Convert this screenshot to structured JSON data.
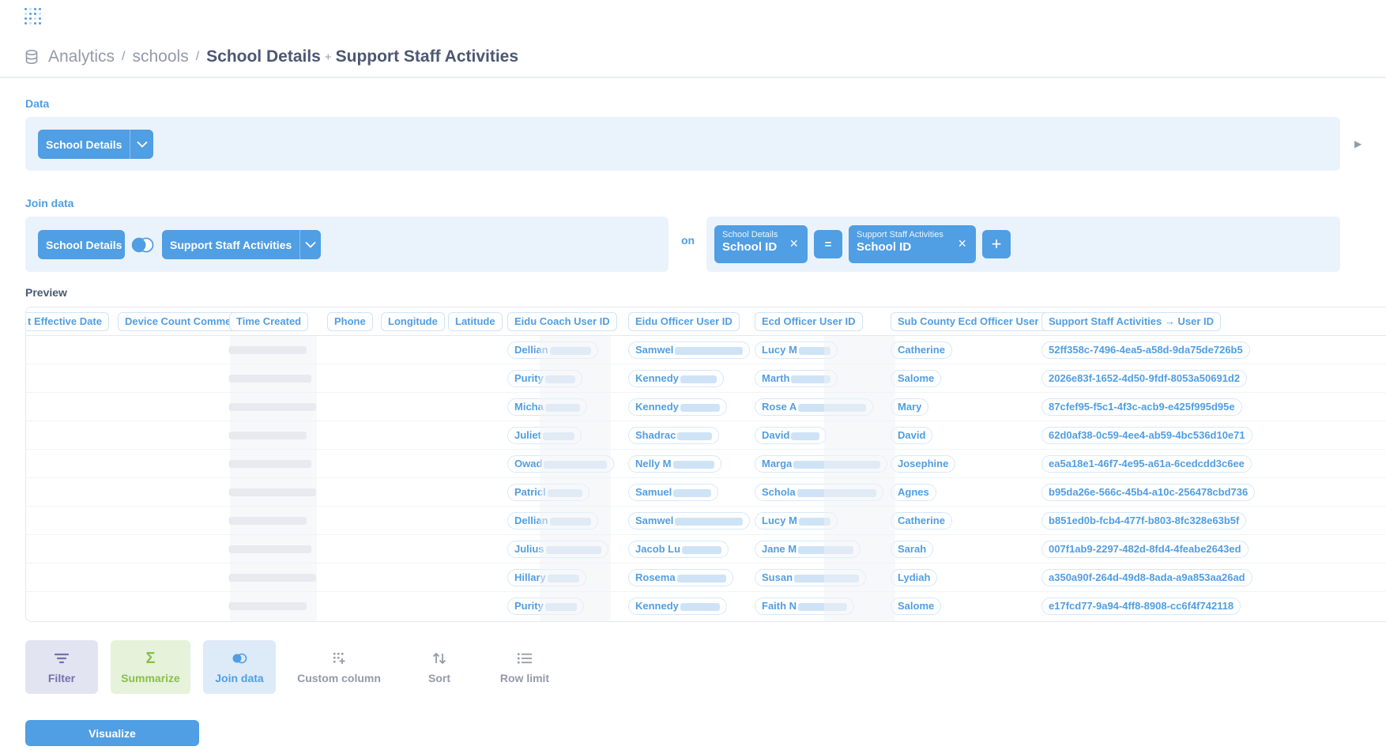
{
  "app": {
    "logo": "metabase-logo"
  },
  "breadcrumb": {
    "database": "Analytics",
    "schema": "schools",
    "table": "School Details",
    "plus": "+",
    "joined": "Support Staff Activities"
  },
  "data_section": {
    "label": "Data",
    "source": "School Details"
  },
  "join_section": {
    "label": "Join data",
    "left_table": "School Details",
    "right_table": "Support Staff Activities",
    "on_label": "on",
    "left_condition": {
      "table": "School Details",
      "column": "School ID"
    },
    "operator": "=",
    "right_condition": {
      "table": "Support Staff Activities",
      "column": "School ID"
    },
    "add_condition": "+"
  },
  "preview": {
    "label": "Preview",
    "columns": [
      "t Effective Date",
      "Device Count Comment",
      "Time Created",
      "Phone",
      "Longitude",
      "Latitude",
      "Eidu Coach User ID",
      "Eidu Officer User ID",
      "Ecd Officer User ID",
      "Sub County Ecd Officer User ID",
      "Support Staff Activities → User ID"
    ],
    "rows": [
      {
        "coach": "Dellian",
        "officer": "Samwel",
        "ecd": "Lucy M",
        "sub": "Catherine",
        "uid": "52ff358c-7496-4ea5-a58d-9da75de726b5"
      },
      {
        "coach": "Purity",
        "officer": "Kennedy",
        "ecd": "Marth",
        "sub": "Salome",
        "uid": "2026e83f-1652-4d50-9fdf-8053a50691d2"
      },
      {
        "coach": "Micha",
        "officer": "Kennedy",
        "ecd": "Rose A",
        "sub": "Mary",
        "uid": "87cfef95-f5c1-4f3c-acb9-e425f995d95e"
      },
      {
        "coach": "Juliet",
        "officer": "Shadrac",
        "ecd": "David",
        "sub": "David",
        "uid": "62d0af38-0c59-4ee4-ab59-4bc536d10e71"
      },
      {
        "coach": "Owad",
        "officer": "Nelly M",
        "ecd": "Marga",
        "sub": "Josephine",
        "uid": "ea5a18e1-46f7-4e95-a61a-6cedcdd3c6ee"
      },
      {
        "coach": "Patricl",
        "officer": "Samuel",
        "ecd": "Schola",
        "sub": "Agnes",
        "uid": "b95da26e-566c-45b4-a10c-256478cbd736"
      },
      {
        "coach": "Dellian",
        "officer": "Samwel",
        "ecd": "Lucy M",
        "sub": "Catherine",
        "uid": "b851ed0b-fcb4-477f-b803-8fc328e63b5f"
      },
      {
        "coach": "Julius",
        "officer": "Jacob Lu",
        "ecd": "Jane M",
        "sub": "Sarah",
        "uid": "007f1ab9-2297-482d-8fd4-4feabe2643ed"
      },
      {
        "coach": "Hillary",
        "officer": "Rosema",
        "ecd": "Susan",
        "sub": "Lydiah",
        "uid": "a350a90f-264d-49d8-8ada-a9a853aa26ad"
      },
      {
        "coach": "Purity",
        "officer": "Kennedy",
        "ecd": "Faith N",
        "sub": "Salome",
        "uid": "e17fcd77-9a94-4ff8-8908-cc6f4f742118"
      }
    ]
  },
  "actions": {
    "filter": "Filter",
    "summarize": "Summarize",
    "join": "Join data",
    "custom_column": "Custom column",
    "sort": "Sort",
    "row_limit": "Row limit"
  },
  "visualize": "Visualize",
  "colors": {
    "brand": "#509ee3",
    "filter": "#7172ad",
    "summarize": "#88bf4d",
    "text": "#4c5773",
    "muted": "#949aab"
  }
}
